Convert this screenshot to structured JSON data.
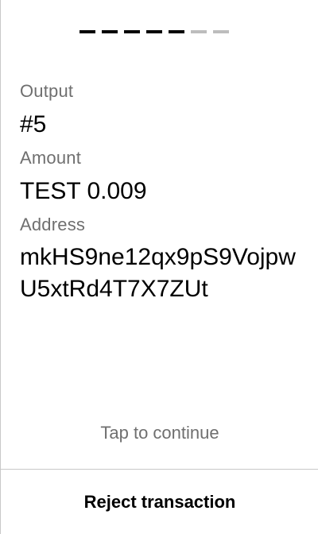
{
  "progress": {
    "total_steps": 7,
    "completed_steps": 5,
    "colors": {
      "active": "#000000",
      "inactive": "#bdbdbd"
    }
  },
  "output": {
    "label": "Output",
    "value": "#5"
  },
  "amount": {
    "label": "Amount",
    "value": "TEST 0.009"
  },
  "address": {
    "label": "Address",
    "value": "mkHS9ne12qx9pS9VojpwU5xtRd4T7X7ZUt"
  },
  "hint": "Tap to continue",
  "reject_label": "Reject transaction"
}
